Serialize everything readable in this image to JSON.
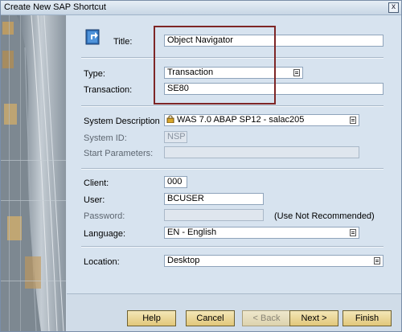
{
  "window": {
    "title": "Create New SAP Shortcut",
    "close_label": "x"
  },
  "form": {
    "title_label": "Title:",
    "title_value": "Object Navigator",
    "type_label": "Type:",
    "type_value": "Transaction",
    "transaction_label": "Transaction:",
    "transaction_value": "SE80",
    "system_description_label": "System Description",
    "system_description_value": "WAS 7.0 ABAP SP12 - salac205",
    "system_id_label": "System ID:",
    "system_id_value": "NSP",
    "start_parameters_label": "Start Parameters:",
    "start_parameters_value": "",
    "client_label": "Client:",
    "client_value": "000",
    "user_label": "User:",
    "user_value": "BCUSER",
    "password_label": "Password:",
    "password_value": "",
    "password_note": "(Use Not Recommended)",
    "language_label": "Language:",
    "language_value": "EN - English",
    "location_label": "Location:",
    "location_value": "Desktop"
  },
  "buttons": {
    "help": "Help",
    "cancel": "Cancel",
    "back": "< Back",
    "next": "Next >",
    "finish": "Finish"
  },
  "colors": {
    "accent": "#7e2626",
    "button": "#e8d08a",
    "background": "#d7e3ef"
  }
}
